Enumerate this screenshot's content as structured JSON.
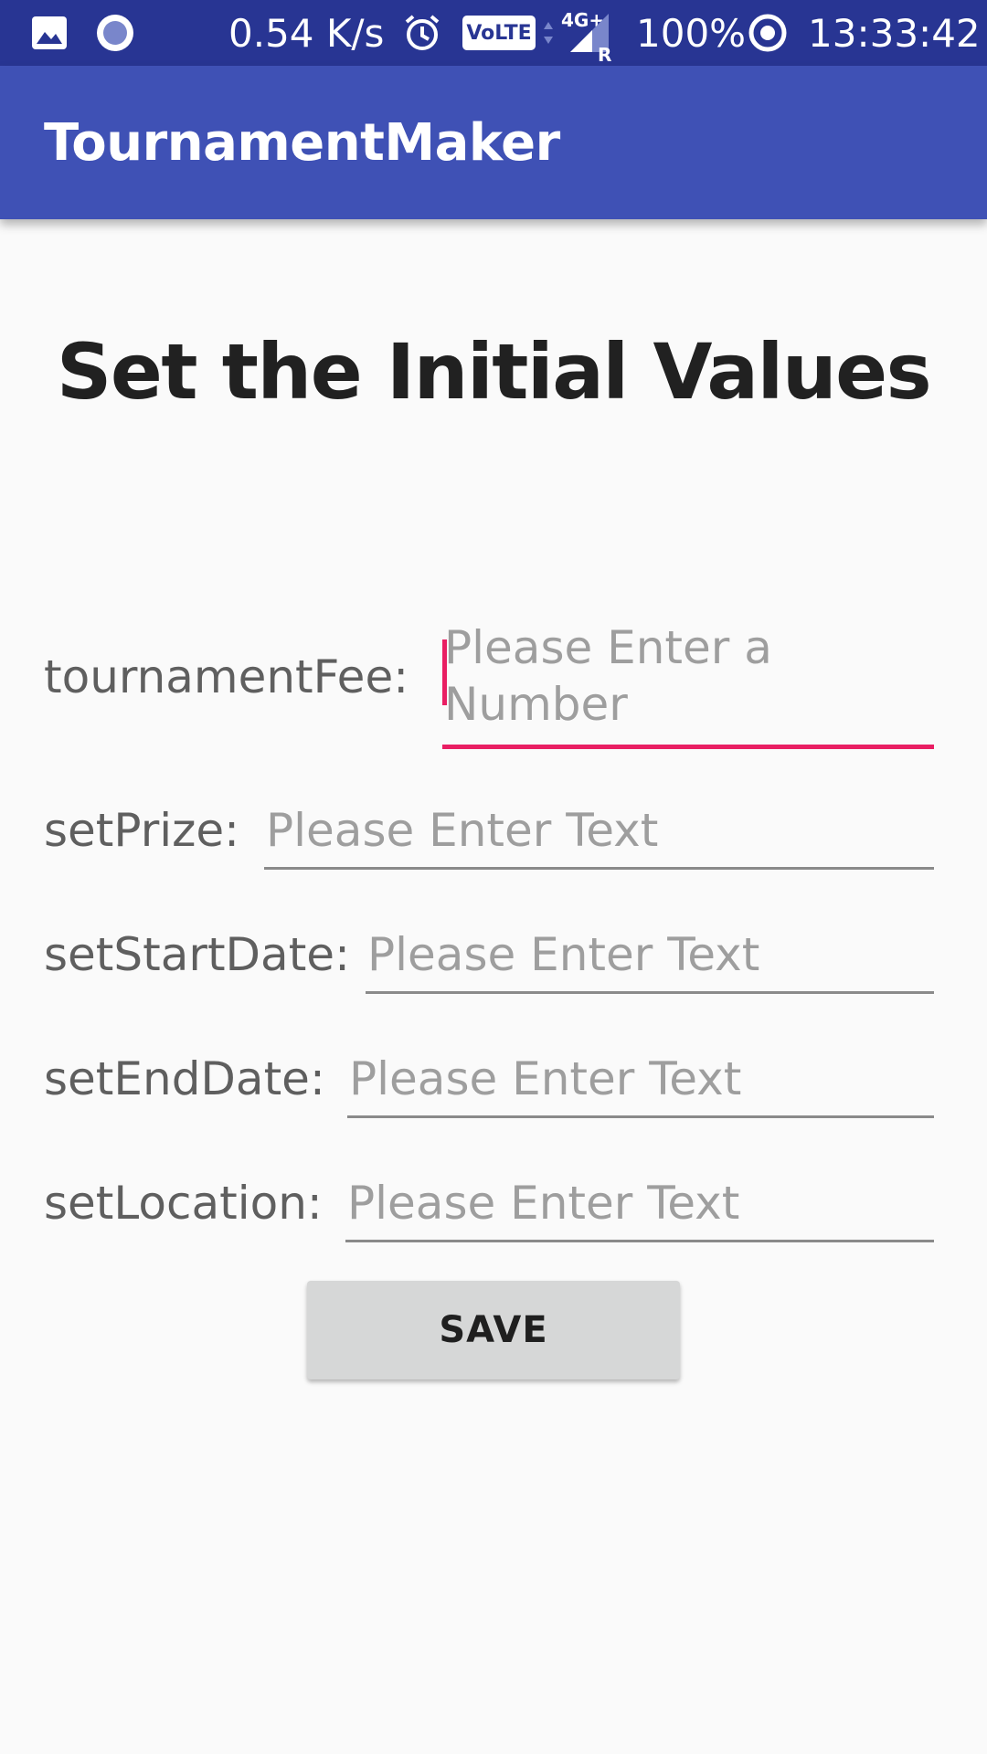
{
  "status_bar": {
    "net_speed": "0.54 K/s",
    "volte": "VoLTE",
    "network": "4G+",
    "roaming": "R",
    "battery": "100%",
    "time": "13:33:42",
    "icons": [
      "image-icon",
      "record-icon",
      "alarm-icon",
      "volte-icon",
      "signal-icon",
      "data-saver-icon"
    ]
  },
  "app_bar": {
    "title": "TournamentMaker",
    "background": "#3f51b5"
  },
  "page": {
    "heading": "Set the Initial Values"
  },
  "form": {
    "fields": [
      {
        "label": "tournamentFee:",
        "placeholder": "Please Enter a Number",
        "focused": true
      },
      {
        "label": "setPrize:",
        "placeholder": "Please Enter Text",
        "focused": false
      },
      {
        "label": "setStartDate:",
        "placeholder": "Please Enter Text",
        "focused": false
      },
      {
        "label": "setEndDate:",
        "placeholder": "Please Enter Text",
        "focused": false
      },
      {
        "label": "setLocation:",
        "placeholder": "Please Enter Text",
        "focused": false
      }
    ],
    "save_label": "SAVE"
  },
  "colors": {
    "status_bar": "#283593",
    "accent": "#e91e63",
    "button": "#d6d7d7"
  }
}
